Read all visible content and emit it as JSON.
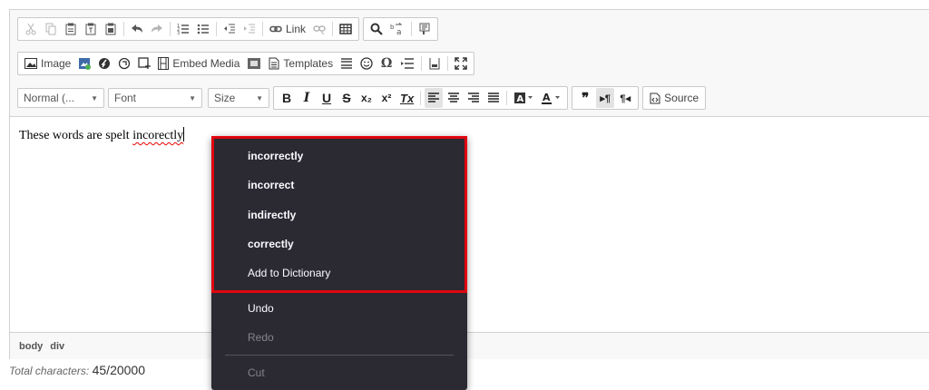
{
  "toolbar": {
    "link_label": "Link",
    "image_label": "Image",
    "embed_label": "Embed Media",
    "templates_label": "Templates",
    "format_combo": "Normal (...",
    "font_combo": "Font",
    "size_combo": "Size",
    "source_label": "Source",
    "omega": "Ω",
    "italic": "I",
    "underline": "U",
    "strike": "S",
    "sub": "x₂",
    "sup": "x²",
    "remove_format": "Tx",
    "quote": "❞",
    "ltr": "▸¶",
    "rtl": "¶◂"
  },
  "content": {
    "text_before": "These words are spelt ",
    "misspelt_word": "incorectly"
  },
  "pathbar": {
    "items": [
      "body",
      "div"
    ]
  },
  "charcount": {
    "label": "Total characters:",
    "value": "45/20000"
  },
  "context_menu": {
    "suggestions": [
      "incorrectly",
      "incorrect",
      "indirectly",
      "correctly"
    ],
    "add_dictionary": "Add to Dictionary",
    "undo": "Undo",
    "redo": "Redo",
    "cut": "Cut"
  },
  "colors": {
    "highlight": "#e0060f",
    "menu_bg": "#2b2a33"
  }
}
